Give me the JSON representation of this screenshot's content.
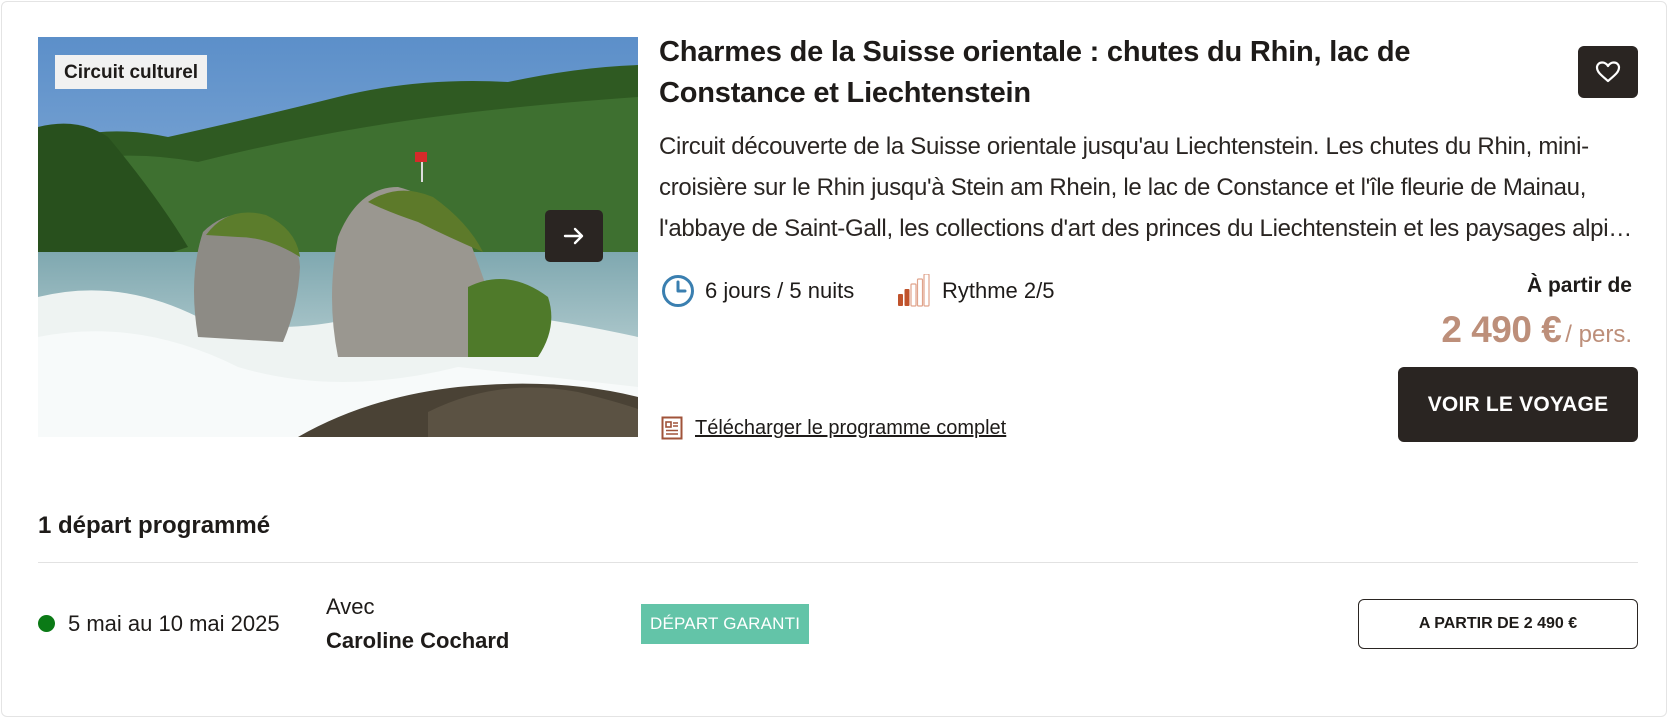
{
  "card": {
    "category_badge": "Circuit culturel",
    "title": "Charmes de la Suisse orientale : chutes du Rhin, lac de Constance et Liechtenstein",
    "description": "Circuit découverte de la Suisse orientale jusqu'au Liechtenstein. Les chutes du Rhin, mini-croisière sur le Rhin jusqu'à Stein am Rhein, le lac de Constance et l'île fleurie de Mainau, l'abbaye de Saint-Gall, les collections d'art des princes du Liechtenstein et les paysages alpins de l'Appenzell.",
    "duration": "6 jours / 5 nuits",
    "rhythm": "Rythme 2/5",
    "rhythm_level": 2,
    "rhythm_max": 5,
    "price_label": "À partir de",
    "price": "2 490 €",
    "price_unit": "/ pers.",
    "cta": "VOIR LE VOYAGE",
    "download_link": "Télécharger le programme complet",
    "icons": {
      "next": "arrow-right-icon",
      "favorite": "heart-icon",
      "duration": "clock-icon",
      "rhythm": "rhythm-bars-icon",
      "download": "document-icon"
    }
  },
  "departures": {
    "heading": "1 départ programmé",
    "items": [
      {
        "dates": "5 mai au 10 mai 2025",
        "guide_prefix": "Avec",
        "guide_name": "Caroline Cochard",
        "status": "DÉPART GARANTI",
        "price_button": "A PARTIR DE 2 490 €"
      }
    ]
  },
  "colors": {
    "dark": "#2a2522",
    "price": "#bd8f7a",
    "status_badge": "#63c4a8",
    "availability_dot": "#0b7a16",
    "clock_icon": "#3a7fb0",
    "rhythm_active": "#c0532c"
  }
}
